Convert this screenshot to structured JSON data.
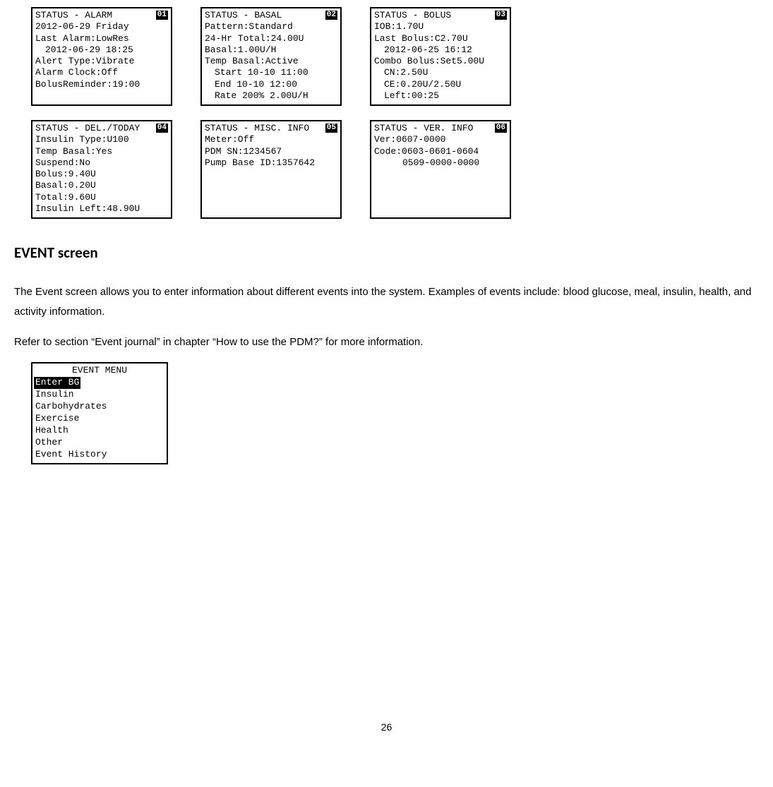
{
  "screens": [
    {
      "badge": "01",
      "title": "STATUS - ALARM",
      "lines": [
        {
          "text": "2012-06-29 Friday"
        },
        {
          "text": "Last Alarm:LowRes"
        },
        {
          "text": "2012-06-29 18:25",
          "indent": 1
        },
        {
          "text": "Alert Type:Vibrate"
        },
        {
          "text": "Alarm Clock:Off"
        },
        {
          "text": "BolusReminder:19:00"
        }
      ]
    },
    {
      "badge": "02",
      "title": "STATUS - BASAL",
      "lines": [
        {
          "text": "Pattern:Standard"
        },
        {
          "text": "24-Hr Total:24.00U"
        },
        {
          "text": "Basal:1.00U/H"
        },
        {
          "text": "Temp Basal:Active"
        },
        {
          "text": "Start 10-10 11:00",
          "indent": 1
        },
        {
          "text": "End 10-10 12:00",
          "indent": 1
        },
        {
          "text": "Rate 200% 2.00U/H",
          "indent": 1
        }
      ]
    },
    {
      "badge": "03",
      "title": "STATUS - BOLUS",
      "lines": [
        {
          "text": "IOB:1.70U"
        },
        {
          "text": "Last Bolus:C2.70U"
        },
        {
          "text": "2012-06-25 16:12",
          "indent": 1
        },
        {
          "text": "Combo Bolus:Set5.00U"
        },
        {
          "text": "CN:2.50U",
          "indent": 1
        },
        {
          "text": "CE:0.20U/2.50U",
          "indent": 1
        },
        {
          "text": "Left:00:25",
          "indent": 1
        }
      ]
    },
    {
      "badge": "04",
      "title": "STATUS - DEL./TODAY",
      "lines": [
        {
          "text": "Insulin Type:U100"
        },
        {
          "text": "Temp Basal:Yes"
        },
        {
          "text": "Suspend:No"
        },
        {
          "text": "Bolus:9.40U"
        },
        {
          "text": "Basal:0.20U"
        },
        {
          "text": "Total:9.60U"
        },
        {
          "text": "Insulin Left:48.90U"
        }
      ]
    },
    {
      "badge": "05",
      "title": "STATUS - MISC. INFO",
      "lines": [
        {
          "text": "Meter:Off"
        },
        {
          "text": "PDM SN:1234567"
        },
        {
          "text": "Pump Base ID:1357642"
        }
      ]
    },
    {
      "badge": "06",
      "title": "STATUS - VER. INFO",
      "lines": [
        {
          "text": "Ver:0607-0000"
        },
        {
          "text": "Code:0603-0601-0604"
        },
        {
          "text": "0509-0000-0000",
          "indent": 2
        }
      ]
    }
  ],
  "heading": "EVENT screen",
  "para1": "The Event screen allows you to enter information about different events into the system. Examples of events include: blood glucose, meal, insulin, health, and activity information.",
  "para2": "Refer to section “Event journal” in chapter “How to use the PDM?” for more information.",
  "eventMenu": {
    "title": "EVENT MENU",
    "items": [
      {
        "label": "Enter BG",
        "selected": true
      },
      {
        "label": "Insulin"
      },
      {
        "label": "Carbohydrates"
      },
      {
        "label": "Exercise"
      },
      {
        "label": "Health"
      },
      {
        "label": "Other"
      },
      {
        "label": "Event History"
      }
    ]
  },
  "pageNumber": "26"
}
